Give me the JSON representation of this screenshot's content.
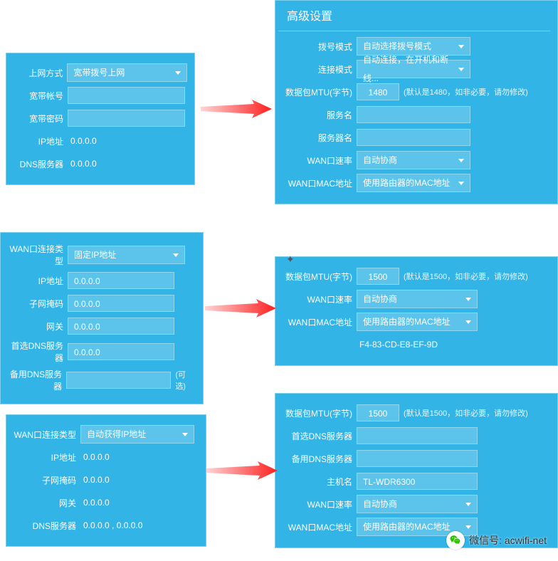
{
  "panel1": {
    "rows": [
      {
        "label": "上网方式",
        "type": "select",
        "value": "宽带拨号上网"
      },
      {
        "label": "宽带帐号",
        "type": "input",
        "value": ""
      },
      {
        "label": "宽带密码",
        "type": "input",
        "value": ""
      },
      {
        "label": "IP地址",
        "type": "text",
        "value": "0.0.0.0"
      },
      {
        "label": "DNS服务器",
        "type": "text",
        "value": "0.0.0.0"
      }
    ]
  },
  "panel2": {
    "title": "高级设置",
    "rows": [
      {
        "label": "拨号模式",
        "type": "select",
        "value": "自动选择拨号模式"
      },
      {
        "label": "连接模式",
        "type": "select",
        "value": "自动连接，在开机和断线..."
      },
      {
        "label": "数据包MTU(字节)",
        "type": "mtu",
        "value": "1480",
        "hint": "(默认是1480，如非必要，请勿修改)"
      },
      {
        "label": "服务名",
        "type": "input",
        "value": ""
      },
      {
        "label": "服务器名",
        "type": "input",
        "value": ""
      },
      {
        "label": "WAN口速率",
        "type": "select",
        "value": "自动协商"
      },
      {
        "label": "WAN口MAC地址",
        "type": "select",
        "value": "使用路由器的MAC地址"
      }
    ]
  },
  "panel3": {
    "rows": [
      {
        "label": "WAN口连接类型",
        "type": "select",
        "value": "固定IP地址"
      },
      {
        "label": "IP地址",
        "type": "input",
        "value": "0.0.0.0"
      },
      {
        "label": "子网掩码",
        "type": "input",
        "value": "0.0.0.0"
      },
      {
        "label": "网关",
        "type": "input",
        "value": "0.0.0.0"
      },
      {
        "label": "首选DNS服务器",
        "type": "input",
        "value": "0.0.0.0"
      },
      {
        "label": "备用DNS服务器",
        "type": "input",
        "value": "",
        "opt": "(可选)"
      }
    ]
  },
  "panel4": {
    "rows": [
      {
        "label": "数据包MTU(字节)",
        "type": "mtu",
        "value": "1500",
        "hint": "(默认是1500，如非必要，请勿修改)"
      },
      {
        "label": "WAN口速率",
        "type": "select",
        "value": "自动协商"
      },
      {
        "label": "WAN口MAC地址",
        "type": "select",
        "value": "使用路由器的MAC地址"
      }
    ],
    "mac": "F4-83-CD-E8-EF-9D"
  },
  "panel5": {
    "rows": [
      {
        "label": "WAN口连接类型",
        "type": "select",
        "value": "自动获得IP地址"
      },
      {
        "label": "IP地址",
        "type": "text",
        "value": "0.0.0.0"
      },
      {
        "label": "子网掩码",
        "type": "text",
        "value": "0.0.0.0"
      },
      {
        "label": "网关",
        "type": "text",
        "value": "0.0.0.0"
      },
      {
        "label": "DNS服务器",
        "type": "text",
        "value": "0.0.0.0 , 0.0.0.0"
      }
    ]
  },
  "panel6": {
    "rows": [
      {
        "label": "数据包MTU(字节)",
        "type": "mtu",
        "value": "1500",
        "hint": "(默认是1500，如非必要，请勿修改)"
      },
      {
        "label": "首选DNS服务器",
        "type": "input",
        "value": ""
      },
      {
        "label": "备用DNS服务器",
        "type": "input",
        "value": ""
      },
      {
        "label": "主机名",
        "type": "input",
        "value": "TL-WDR6300"
      },
      {
        "label": "WAN口速率",
        "type": "select",
        "value": "自动协商"
      },
      {
        "label": "WAN口MAC地址",
        "type": "select",
        "value": "使用路由器的MAC地址"
      }
    ]
  },
  "wechat": {
    "label": "微信号",
    "value": "acwifi-net"
  }
}
